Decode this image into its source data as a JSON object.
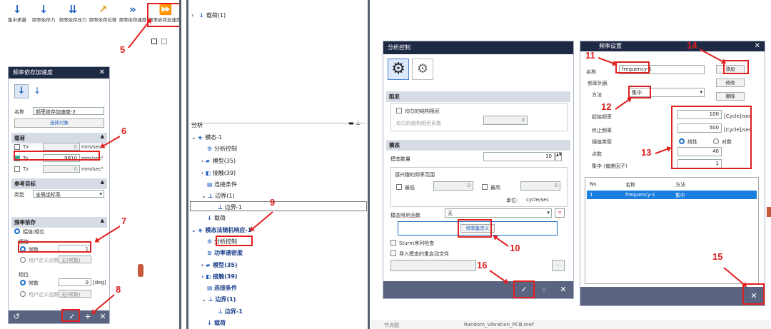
{
  "ribbon": {
    "items": [
      {
        "label": "集中质量",
        "icon": "mass-arrow-icon"
      },
      {
        "label": "频率依存力",
        "icon": "force-arrow-icon"
      },
      {
        "label": "频率依存压力",
        "icon": "pressure-arrow-icon"
      },
      {
        "label": "频率依存位移",
        "icon": "displacement-icon"
      },
      {
        "label": "频率依存速度",
        "icon": "velocity-icon"
      },
      {
        "label": "频率依存加速度",
        "icon": "acceleration-icon"
      }
    ]
  },
  "left_panel": {
    "title": "频率依存加速度",
    "name_label": "名称",
    "name_value": "频率依存加速度-2",
    "select_btn": "选择对象",
    "load_section": "载荷",
    "tx": "Tx",
    "ty": "Ty",
    "tz": "Tz",
    "tx_val": "0",
    "ty_val": "9810",
    "tz_val": "0",
    "unit": "mm/sec²",
    "ref_section": "参考目标",
    "type_label": "类型",
    "type_value": "全局坐标系",
    "freq_section": "频率依存",
    "scale_phase": "幅值/相位",
    "scale": "幅值",
    "const": "常数",
    "const_val": "1",
    "user_def": "用户定义函数",
    "no_func": "无(常数)",
    "phase": "相位",
    "phase_val": "0",
    "deg": "[deg]",
    "no_func2": "无(常数)"
  },
  "tree_top": {
    "label": "载荷(1)"
  },
  "tree": {
    "header": "分析",
    "items": [
      {
        "label": "模态-1"
      },
      {
        "label": "分析控制"
      },
      {
        "label": "模型(35)"
      },
      {
        "label": "接触(39)"
      },
      {
        "label": "连接条件"
      },
      {
        "label": "边界(1)"
      },
      {
        "label": "边界-1"
      },
      {
        "label": "载荷"
      },
      {
        "label": "模态法随机响应-1"
      },
      {
        "label": "分析控制"
      },
      {
        "label": "功率谱密度"
      },
      {
        "label": "模型(35)"
      },
      {
        "label": "接触(39)"
      },
      {
        "label": "连接条件"
      },
      {
        "label": "边界(1)"
      },
      {
        "label": "边界-1"
      },
      {
        "label": "载荷"
      }
    ]
  },
  "analysis_ctrl": {
    "title": "分析控制",
    "damping": "阻尼",
    "uniform_damping": "均匀的结构阻尼",
    "uniform_coef": "均匀的结构阻尼系数",
    "coef_val": "0",
    "modal": "模态",
    "mode_count_label": "模态数量",
    "mode_count": "10",
    "freq_range": "感兴趣的频率范围",
    "lowest": "最低",
    "highest": "最高",
    "low_val": "0",
    "high_val": "0",
    "unit_label": "单位:",
    "unit": "cycle/sec",
    "damping_func": "模态阻尼函数",
    "damping_func_val": "无",
    "freq_def_btn": "频率集定义",
    "sturm": "Sturm序列检查",
    "import_file": "导入模态的重启动文件"
  },
  "freq_set": {
    "title": "频率设置",
    "name_label": "名称",
    "name_value": "frequency-1",
    "add": "添加",
    "modify": "修改",
    "delete": "删除",
    "freq_list": "频率列表",
    "method_label": "方法",
    "method": "集中",
    "start_label": "起始频率",
    "start_val": "100",
    "end_label": "终止频率",
    "end_val": "500",
    "unit": "[Cycle]/sec",
    "interp_label": "插值类型",
    "linear": "线性",
    "log": "对数",
    "points_label": "点数",
    "points_val": "40",
    "cluster_label": "集中 (偏差因子)",
    "cluster_val": "1",
    "cols": [
      "No.",
      "名称",
      "方法"
    ],
    "rows": [
      {
        "no": "1",
        "name": "frequency-1",
        "method": "集中"
      }
    ]
  },
  "bottom": {
    "tab1": "节点图",
    "tab2": "Random_Vibration_PCB.mef"
  },
  "markers": [
    "5",
    "6",
    "7",
    "8",
    "9",
    "10",
    "11",
    "12",
    "13",
    "14",
    "15",
    "16"
  ],
  "colors": {
    "title": "#1e2a44",
    "bar": "#5a6480",
    "accent": "#e02020",
    "select": "#1a7ee0"
  }
}
